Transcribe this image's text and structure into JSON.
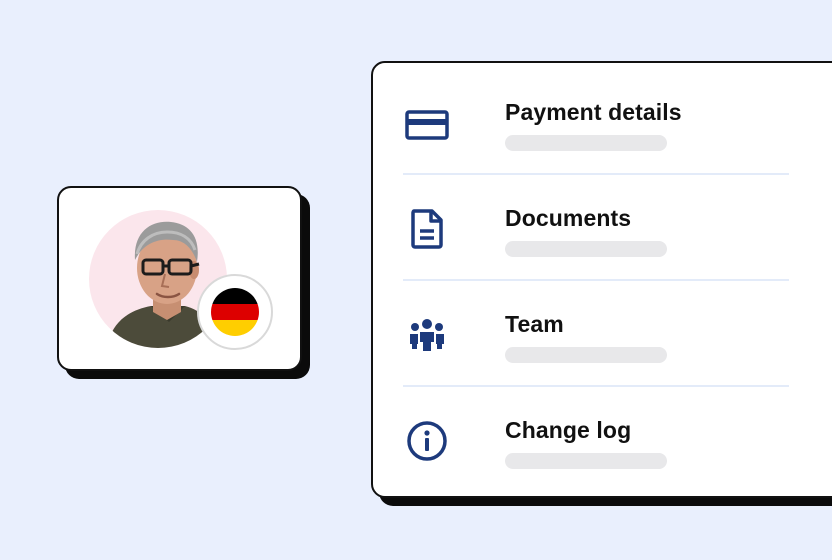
{
  "colors": {
    "background": "#e9effd",
    "icon": "#1d3a7c",
    "text": "#111111",
    "placeholder_bar": "#e8e8ea",
    "divider": "#e3ebf9",
    "avatar_backdrop": "#fbe6ec"
  },
  "profile": {
    "avatar_icon": "person-photo",
    "flag_icon": "germany-flag-icon",
    "flag_colors": [
      "#000000",
      "#dd0000",
      "#ffce00"
    ]
  },
  "menu": {
    "items": [
      {
        "icon": "credit-card-icon",
        "label": "Payment details"
      },
      {
        "icon": "document-icon",
        "label": "Documents"
      },
      {
        "icon": "team-icon",
        "label": "Team"
      },
      {
        "icon": "info-icon",
        "label": "Change log"
      }
    ]
  }
}
